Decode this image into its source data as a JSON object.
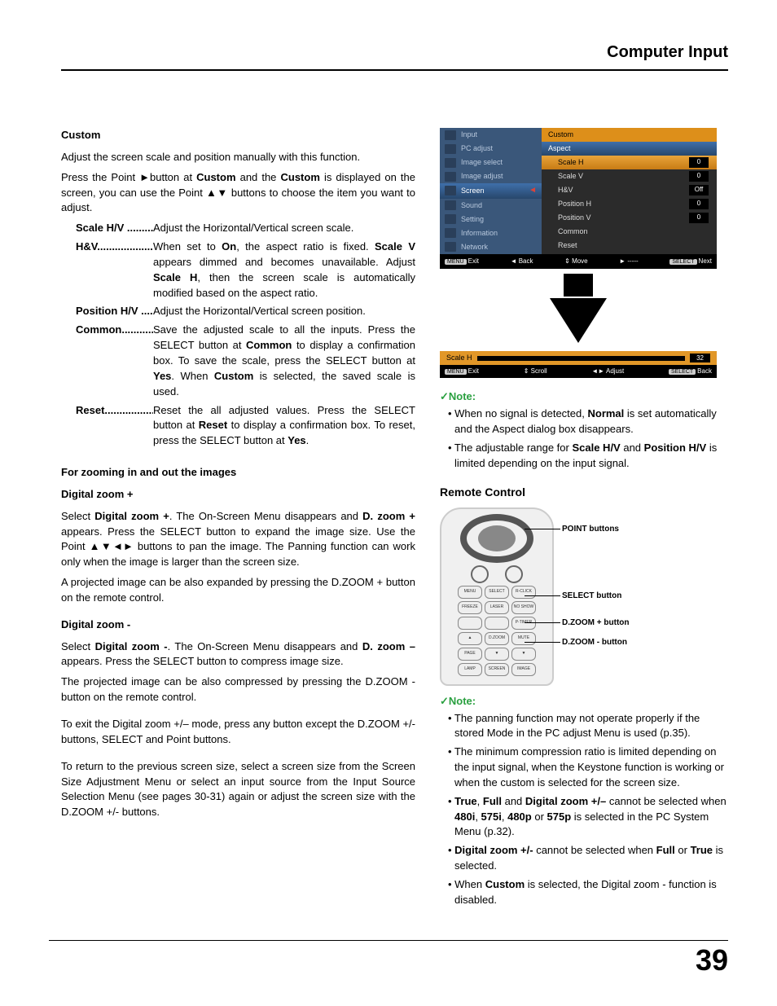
{
  "header": {
    "title": "Computer Input"
  },
  "page_number": "39",
  "left": {
    "custom_heading": "Custom",
    "custom_intro": "Adjust the screen scale and position manually with this function.",
    "custom_press": "Press the Point ►button at Custom and the Custom is displayed on the screen, you can use the Point ▲▼ buttons to choose the item you want to adjust.",
    "defs": [
      {
        "term": "Scale H/V ..........",
        "desc": "Adjust the Horizontal/Vertical screen scale."
      },
      {
        "term": "H&V...................",
        "desc": "When set to On, the aspect ratio is fixed. Scale V appears dimmed and becomes unavailable. Adjust Scale H, then the screen scale is automatically modified based on the aspect ratio."
      },
      {
        "term": "Position H/V .....",
        "desc": "Adjust the Horizontal/Vertical screen position."
      },
      {
        "term": "Common...........",
        "desc": "Save the adjusted scale to all the inputs. Press the SELECT button at Common to display a confirmation box. To save the scale, press the SELECT button at Yes. When Custom is selected, the saved scale is used."
      },
      {
        "term": "Reset.................",
        "desc": "Reset the all adjusted values. Press the SELECT button at Reset to display a confirmation box. To reset, press the SELECT button at Yes."
      }
    ],
    "zoom_heading": "For zooming in and out the images",
    "dz_plus_head": "Digital zoom +",
    "dz_plus_p1": "Select Digital zoom +. The On-Screen Menu disappears and D. zoom + appears. Press the SELECT button to expand the image size. Use the Point ▲▼◄► buttons to pan the image. The Panning function can work only when the image is larger than the screen size.",
    "dz_plus_p2": "A projected image can be also expanded by pressing the D.ZOOM + button on the remote control.",
    "dz_minus_head": "Digital zoom -",
    "dz_minus_p1": "Select Digital zoom -. The On-Screen Menu disappears and D. zoom – appears. Press the SELECT button to compress image size.",
    "dz_minus_p2": "The projected image can be also compressed by pressing the D.ZOOM - button on the remote control.",
    "dz_exit": "To exit the Digital zoom +/– mode, press any button except the D.ZOOM +/- buttons, SELECT and Point buttons.",
    "dz_return": "To return to the previous screen size, select a screen size from the Screen Size Adjustment Menu or select an input source from the Input Source Selection Menu (see pages 30-31) again or adjust the screen size with the D.ZOOM +/- buttons."
  },
  "osd": {
    "menu_items": [
      "Input",
      "PC adjust",
      "Image select",
      "Image adjust",
      "Screen",
      "Sound",
      "Setting",
      "Information",
      "Network"
    ],
    "menu_selected_index": 4,
    "right_head": "Custom",
    "right_sub": "Aspect",
    "rows": [
      {
        "label": "Scale H",
        "value": "0",
        "selected": true
      },
      {
        "label": "Scale V",
        "value": "0"
      },
      {
        "label": "H&V",
        "value": "Off"
      },
      {
        "label": "Position H",
        "value": "0"
      },
      {
        "label": "Position V",
        "value": "0"
      },
      {
        "label": "Common",
        "value": ""
      },
      {
        "label": "Reset",
        "value": ""
      }
    ],
    "footer": {
      "exit": "Exit",
      "back": "◄ Back",
      "move": "Move",
      "dash": "► -----",
      "next": "Next"
    },
    "bar": {
      "label": "Scale H",
      "value": "32"
    },
    "bar_footer": {
      "exit": "Exit",
      "scroll": "Scroll",
      "adjust": "Adjust",
      "back": "Back"
    }
  },
  "note1": {
    "head": "✓Note:",
    "items": [
      "When no signal is detected, Normal is set automatically and the Aspect dialog box disappears.",
      "The adjustable range for Scale H/V and Position H/V is limited depending on the input signal."
    ]
  },
  "remote": {
    "heading": "Remote Control",
    "labels": {
      "point": "POINT buttons",
      "select": "SELECT button",
      "dzplus": "D.ZOOM + button",
      "dzminus": "D.ZOOM - button"
    },
    "btns_row1": [
      "MENU",
      "SELECT",
      "R-CLICK"
    ],
    "btns_row2": [
      "FREEZE",
      "LASER",
      "NO SHOW"
    ],
    "btns_row3": [
      "",
      "",
      "P-TIMER"
    ],
    "btns_row4": [
      "▲",
      "D.ZOOM",
      "MUTE"
    ],
    "btns_row5": [
      "PAGE",
      "▼",
      "▼"
    ],
    "btns_row6": [
      "LAMP",
      "SCREEN",
      "IMAGE"
    ]
  },
  "note2": {
    "head": "✓Note:",
    "items": [
      "The panning function may not operate properly if the stored Mode in the PC adjust Menu is used (p.35).",
      "The minimum compression ratio is limited depending on the input signal, when the Keystone function is working or when the custom is selected for the screen size.",
      "True, Full and Digital zoom +/– cannot be selected when 480i, 575i, 480p or 575p is selected in the PC System Menu (p.32).",
      "Digital zoom +/- cannot be selected when Full or True is selected.",
      "When Custom is selected, the Digital zoom - function is disabled."
    ]
  }
}
